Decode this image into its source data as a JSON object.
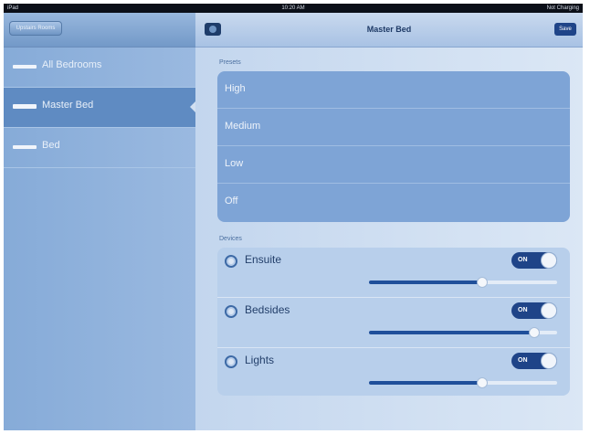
{
  "status_bar": {
    "left": "iPad",
    "time": "10:20 AM",
    "right": "Not Charging"
  },
  "nav": {
    "back_label": "Upstairs Rooms",
    "title": "Master Bed",
    "save_label": "Save"
  },
  "rooms": [
    {
      "label": "All Bedrooms",
      "selected": false
    },
    {
      "label": "Master Bed",
      "selected": true
    },
    {
      "label": "Bed",
      "selected": false
    }
  ],
  "presets": {
    "heading": "Presets",
    "items": [
      "High",
      "Medium",
      "Low",
      "Off"
    ]
  },
  "devices": {
    "heading": "Devices",
    "items": [
      {
        "label": "Ensuite",
        "toggle": "ON",
        "level": 0.6
      },
      {
        "label": "Bedsides",
        "toggle": "ON",
        "level": 0.88
      },
      {
        "label": "Lights",
        "toggle": "ON",
        "level": 0.6
      }
    ]
  },
  "colors": {
    "accent": "#1f4488",
    "selected_row": "#5f8bc2",
    "panel": "#7ea4d6"
  }
}
